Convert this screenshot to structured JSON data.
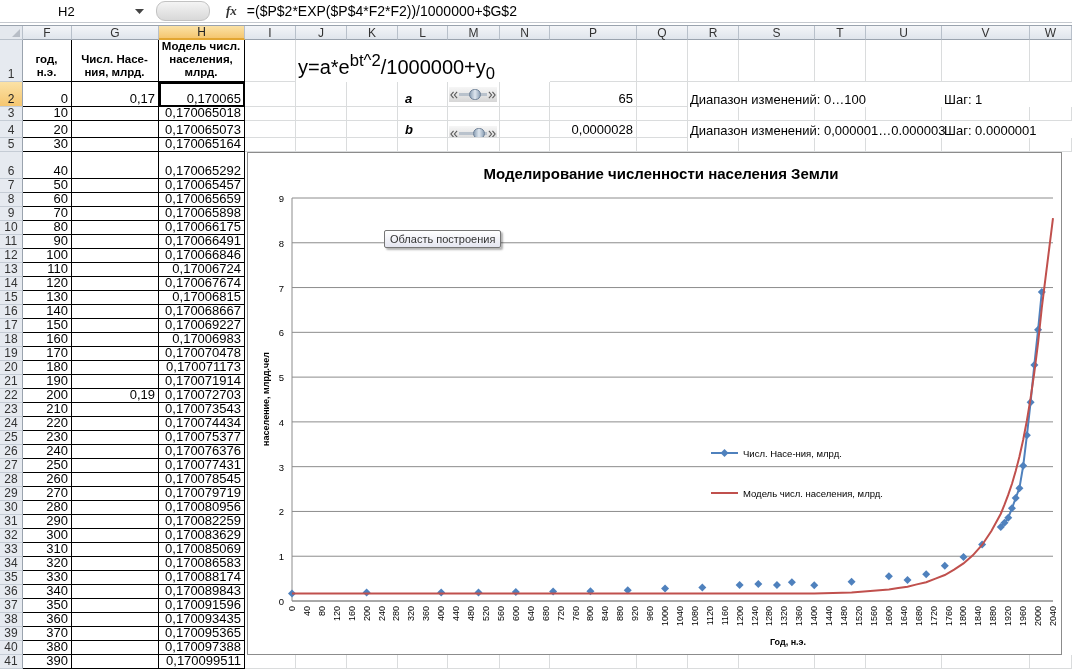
{
  "formula_bar": {
    "name_box": "H2",
    "function_label": "fx",
    "formula": "=($P$2*EXP($P$4*F2*F2))/1000000+$G$2"
  },
  "sheet": {
    "columns": [
      {
        "label": "F",
        "selected": false
      },
      {
        "label": "G",
        "selected": false
      },
      {
        "label": "H",
        "selected": true
      },
      {
        "label": "I",
        "selected": false
      },
      {
        "label": "J",
        "selected": false
      },
      {
        "label": "K",
        "selected": false
      },
      {
        "label": "L",
        "selected": false
      },
      {
        "label": "M",
        "selected": false
      },
      {
        "label": "N",
        "selected": false
      },
      {
        "label": "P",
        "selected": false
      },
      {
        "label": "Q",
        "selected": false
      },
      {
        "label": "R",
        "selected": false
      },
      {
        "label": "S",
        "selected": false
      },
      {
        "label": "T",
        "selected": false
      },
      {
        "label": "U",
        "selected": false
      },
      {
        "label": "V",
        "selected": false
      },
      {
        "label": "W",
        "selected": false
      }
    ],
    "rows": [
      {
        "number": "1",
        "selected": false,
        "cells": {
          "f": "год, н.э.",
          "g": "Числ. Насе-ния, млрд.",
          "h": "Модель числ. населения, млрд.",
          "j": "y=a*e$^{bt^2}$/1000000+y$_{0}$"
        }
      },
      {
        "number": "2",
        "selected": true,
        "cells": {
          "f": "0",
          "g": "0,17",
          "h": "0,170065",
          "l": "a",
          "p": "65",
          "r": "Диапазон изменений: 0…100",
          "v": "Шаг: 1"
        },
        "slider": {
          "level": 0.65
        }
      },
      {
        "number": "3",
        "selected": false,
        "cells": {
          "f": "10",
          "h": "0,170065018"
        }
      },
      {
        "number": "4",
        "selected": false,
        "cells": {
          "f": "20",
          "h": "0,170065073",
          "l": "b",
          "p": "0,0000028",
          "r": "Диапазон изменений: 0,000001…0.000003",
          "v": "Шаг: 0.0000001"
        },
        "slider": {
          "level": 0.9
        }
      },
      {
        "number": "5",
        "selected": false,
        "cells": {
          "f": "30",
          "h": "0,170065164"
        }
      },
      {
        "number": "6",
        "selected": false,
        "cells": {
          "f": "40",
          "h": "0,170065292"
        }
      },
      {
        "number": "7",
        "selected": false,
        "cells": {
          "f": "50",
          "h": "0,170065457"
        }
      },
      {
        "number": "8",
        "selected": false,
        "cells": {
          "f": "60",
          "h": "0,170065659"
        }
      },
      {
        "number": "9",
        "selected": false,
        "cells": {
          "f": "70",
          "h": "0,170065898"
        }
      },
      {
        "number": "10",
        "selected": false,
        "cells": {
          "f": "80",
          "h": "0,170066175"
        }
      },
      {
        "number": "11",
        "selected": false,
        "cells": {
          "f": "90",
          "h": "0,170066491"
        }
      },
      {
        "number": "12",
        "selected": false,
        "cells": {
          "f": "100",
          "h": "0,170066846"
        }
      },
      {
        "number": "13",
        "selected": false,
        "cells": {
          "f": "110",
          "h": "0,17006724"
        }
      },
      {
        "number": "14",
        "selected": false,
        "cells": {
          "f": "120",
          "h": "0,170067674"
        }
      },
      {
        "number": "15",
        "selected": false,
        "cells": {
          "f": "130",
          "h": "0,17006815"
        }
      },
      {
        "number": "16",
        "selected": false,
        "cells": {
          "f": "140",
          "h": "0,170068667"
        }
      },
      {
        "number": "17",
        "selected": false,
        "cells": {
          "f": "150",
          "h": "0,170069227"
        }
      },
      {
        "number": "18",
        "selected": false,
        "cells": {
          "f": "160",
          "h": "0,17006983"
        }
      },
      {
        "number": "19",
        "selected": false,
        "cells": {
          "f": "170",
          "h": "0,170070478"
        }
      },
      {
        "number": "20",
        "selected": false,
        "cells": {
          "f": "180",
          "h": "0,170071173"
        }
      },
      {
        "number": "21",
        "selected": false,
        "cells": {
          "f": "190",
          "h": "0,170071914"
        }
      },
      {
        "number": "22",
        "selected": false,
        "cells": {
          "f": "200",
          "g": "0,19",
          "h": "0,170072703"
        }
      },
      {
        "number": "23",
        "selected": false,
        "cells": {
          "f": "210",
          "h": "0,170073543"
        }
      },
      {
        "number": "24",
        "selected": false,
        "cells": {
          "f": "220",
          "h": "0,170074434"
        }
      },
      {
        "number": "25",
        "selected": false,
        "cells": {
          "f": "230",
          "h": "0,170075377"
        }
      },
      {
        "number": "26",
        "selected": false,
        "cells": {
          "f": "240",
          "h": "0,170076376"
        }
      },
      {
        "number": "27",
        "selected": false,
        "cells": {
          "f": "250",
          "h": "0,170077431"
        }
      },
      {
        "number": "28",
        "selected": false,
        "cells": {
          "f": "260",
          "h": "0,170078545"
        }
      },
      {
        "number": "29",
        "selected": false,
        "cells": {
          "f": "270",
          "h": "0,170079719"
        }
      },
      {
        "number": "30",
        "selected": false,
        "cells": {
          "f": "280",
          "h": "0,170080956"
        }
      },
      {
        "number": "31",
        "selected": false,
        "cells": {
          "f": "290",
          "h": "0,170082259"
        }
      },
      {
        "number": "32",
        "selected": false,
        "cells": {
          "f": "300",
          "h": "0,170083629"
        }
      },
      {
        "number": "33",
        "selected": false,
        "cells": {
          "f": "310",
          "h": "0,170085069"
        }
      },
      {
        "number": "34",
        "selected": false,
        "cells": {
          "f": "320",
          "h": "0,170086583"
        }
      },
      {
        "number": "35",
        "selected": false,
        "cells": {
          "f": "330",
          "h": "0,170088174"
        }
      },
      {
        "number": "36",
        "selected": false,
        "cells": {
          "f": "340",
          "h": "0,170089843"
        }
      },
      {
        "number": "37",
        "selected": false,
        "cells": {
          "f": "350",
          "h": "0,170091596"
        }
      },
      {
        "number": "38",
        "selected": false,
        "cells": {
          "f": "360",
          "h": "0,170093435"
        }
      },
      {
        "number": "39",
        "selected": false,
        "cells": {
          "f": "370",
          "h": "0,170095365"
        }
      },
      {
        "number": "40",
        "selected": false,
        "cells": {
          "f": "380",
          "h": "0,170097388"
        }
      },
      {
        "number": "41",
        "selected": false,
        "cells": {
          "f": "390",
          "h": "0,170099511"
        }
      }
    ]
  },
  "chart": {
    "tooltip": "Область построения",
    "chart_data": {
      "type": "line",
      "title": "Моделирование численности населения Земли",
      "xlabel": "Год, н.э.",
      "ylabel": "население, млрд.чел",
      "x": [
        0,
        100,
        200,
        300,
        400,
        450,
        500,
        550,
        600,
        650,
        700,
        750,
        800,
        850,
        900,
        950,
        1000,
        1050,
        1100,
        1150,
        1200,
        1225,
        1250,
        1275,
        1300,
        1320,
        1340,
        1370,
        1400,
        1450,
        1500,
        1550,
        1600,
        1625,
        1650,
        1675,
        1700,
        1725,
        1750,
        1775,
        1800,
        1825,
        1850,
        1875,
        1900,
        1910,
        1920,
        1930,
        1940,
        1950,
        1960,
        1970,
        1980,
        1990,
        2000,
        2010,
        2040
      ],
      "series": [
        {
          "name": "Числ. Насе-ния, млрд.",
          "color": "#4f81bd",
          "marker": "diamond",
          "values": [
            0.17,
            null,
            0.19,
            null,
            0.19,
            null,
            0.19,
            null,
            0.2,
            null,
            0.21,
            null,
            0.22,
            null,
            0.24,
            null,
            0.28,
            null,
            0.3,
            null,
            0.36,
            null,
            0.38,
            null,
            0.36,
            null,
            0.42,
            null,
            0.35,
            null,
            0.43,
            null,
            0.55,
            null,
            0.47,
            null,
            0.6,
            null,
            0.79,
            null,
            0.98,
            null,
            1.26,
            null,
            1.65,
            1.75,
            1.86,
            2.07,
            2.3,
            2.52,
            3.02,
            3.7,
            4.44,
            5.27,
            6.06,
            6.9,
            null
          ]
        },
        {
          "name": "Модель числ. населения, млрд.",
          "color": "#c0504d",
          "values": [
            0.17,
            0.17,
            0.17,
            0.17,
            0.17,
            0.17,
            0.17,
            0.17,
            0.17,
            0.17,
            0.17,
            0.17,
            0.17,
            0.17,
            0.17,
            0.17,
            0.17,
            0.17,
            0.17,
            0.17,
            0.17,
            0.17,
            0.17,
            0.17,
            0.17,
            0.17,
            0.17,
            0.17,
            0.17,
            0.18,
            0.19,
            0.22,
            0.26,
            0.29,
            0.32,
            0.37,
            0.42,
            0.5,
            0.58,
            0.7,
            0.84,
            1.02,
            1.25,
            1.56,
            1.95,
            2.15,
            2.37,
            2.62,
            2.9,
            3.22,
            3.6,
            4.03,
            4.53,
            5.1,
            5.77,
            6.55,
            8.55
          ]
        }
      ],
      "xlim": [
        0,
        2040
      ],
      "ylim": [
        0,
        9
      ],
      "xticks": [
        0,
        40,
        80,
        120,
        160,
        200,
        240,
        280,
        320,
        360,
        400,
        440,
        480,
        520,
        560,
        600,
        640,
        680,
        720,
        760,
        800,
        840,
        880,
        920,
        960,
        1000,
        1040,
        1080,
        1120,
        1160,
        1200,
        1240,
        1280,
        1320,
        1360,
        1400,
        1440,
        1480,
        1520,
        1560,
        1600,
        1640,
        1680,
        1720,
        1760,
        1800,
        1840,
        1880,
        1920,
        1960,
        2000,
        2040
      ],
      "yticks": [
        0,
        1,
        2,
        3,
        4,
        5,
        6,
        7,
        8,
        9
      ],
      "grid": true,
      "legend": true
    }
  }
}
